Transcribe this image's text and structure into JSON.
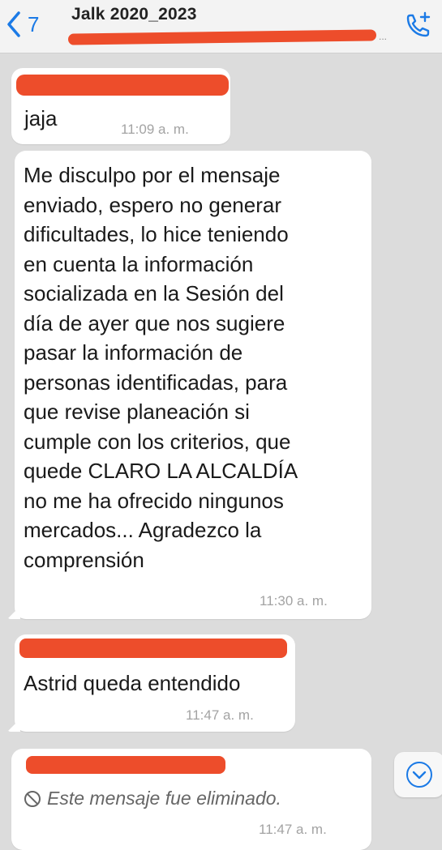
{
  "header": {
    "back_count": "7",
    "title": "Jalk 2020_2023",
    "subtitle_ellipsis": "..."
  },
  "messages": [
    {
      "text": "jaja",
      "time": "11:09 a. m."
    },
    {
      "text": "Me disculpo por el mensaje\nenviado, espero no generar\ndificultades, lo hice teniendo\nen cuenta la información\nsocializada en la Sesión del\ndía de ayer que nos sugiere\npasar la información de\npersonas identificadas, para\nque revise planeación si\ncumple con los criterios, que\nquede CLARO LA ALCALDÍA\nno me ha ofrecido ningunos\nmercados... Agradezco la\ncomprensión",
      "time": "11:30 a. m."
    },
    {
      "text": "Astrid queda entendido",
      "time": "11:47 a. m."
    },
    {
      "text": "Este mensaje fue eliminado.",
      "time": "11:47 a. m."
    }
  ],
  "colors": {
    "accent": "#1b7ae6",
    "redaction": "#ed4d2b",
    "background": "#dcdcdc"
  },
  "icons": [
    "chevron-left-icon",
    "add-call-icon",
    "blocked-icon",
    "chevron-down-icon"
  ]
}
